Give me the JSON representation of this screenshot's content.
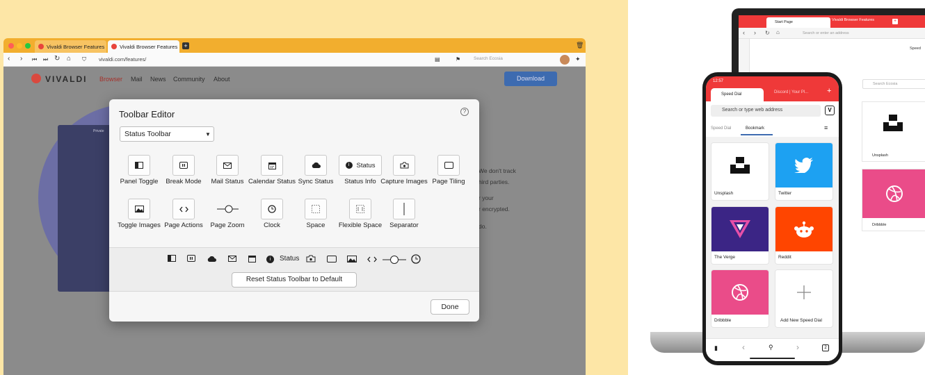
{
  "browser": {
    "tabs": [
      "Vivaldi Browser Features |",
      "Vivaldi Browser Features |"
    ],
    "url": "vivaldi.com/features/",
    "search_placeholder": "Search Ecosia"
  },
  "site": {
    "logo": "VIVALDI",
    "menu": [
      "Browser",
      "Mail",
      "News",
      "Community",
      "About"
    ],
    "download": "Download",
    "private_tab": "Private",
    "bg_text": [
      "We don't track",
      "hird parties.",
      "r your",
      "r encrypted.",
      "do."
    ]
  },
  "dialog": {
    "title": "Toolbar Editor",
    "help": "?",
    "select_value": "Status Toolbar",
    "row1": [
      "Panel Toggle",
      "Break Mode",
      "Mail Status",
      "Calendar Status",
      "Sync Status",
      "Status Info",
      "Capture Images",
      "Page Tiling"
    ],
    "row2": [
      "Toggle Images",
      "Page Actions",
      "Page Zoom",
      "Clock",
      "Space",
      "Flexible Space",
      "Separator"
    ],
    "status_label": "Status",
    "reset_button": "Reset Status Toolbar to Default",
    "done_button": "Done"
  },
  "laptop": {
    "tabs": [
      "Start Page",
      "Vivaldi Browser Features"
    ],
    "address_placeholder": "Search or enter an address",
    "search_placeholder": "Search Ecosia",
    "speed_label": "Speed",
    "tiles": [
      "Unsplash",
      "Dribbble"
    ]
  },
  "phone": {
    "time": "12:57",
    "tabs": [
      "Speed Dial",
      "Discord | Your Pl..."
    ],
    "address_placeholder": "Search or type web address",
    "subtabs": [
      "Speed Dial",
      "Bookmark"
    ],
    "tiles": [
      "Unsplash",
      "Twitter",
      "The Verge",
      "Reddit",
      "Dribbble",
      "Add New Speed Dial"
    ]
  },
  "colors": {
    "vivaldi_red": "#ef3939",
    "twitter": "#1da1f2",
    "verge": "#3b2585",
    "reddit": "#ff4500",
    "dribbble": "#ea4c89"
  }
}
